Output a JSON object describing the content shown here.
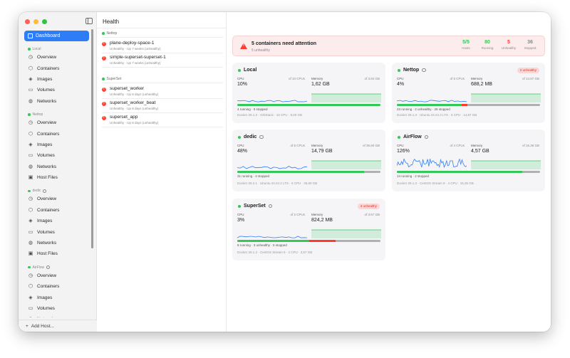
{
  "sidebar": {
    "dashboard_label": "Dashboard",
    "add_host_label": "Add Host...",
    "hosts": [
      {
        "name": "Local",
        "items": [
          "Overview",
          "Containers",
          "Images",
          "Volumes",
          "Networks"
        ]
      },
      {
        "name": "Nettop",
        "items": [
          "Overview",
          "Containers",
          "Images",
          "Volumes",
          "Networks",
          "Host Files"
        ]
      },
      {
        "name": "dedic",
        "items": [
          "Overview",
          "Containers",
          "Images",
          "Volumes",
          "Networks",
          "Host Files"
        ]
      },
      {
        "name": "AirFlow",
        "items": [
          "Overview",
          "Containers",
          "Images",
          "Volumes",
          "Networks"
        ]
      }
    ]
  },
  "health": {
    "title": "Health",
    "groups": [
      {
        "name": "Nettop",
        "rows": [
          {
            "name": "plane-deploy-space-1",
            "status": "Unhealthy · Up 7 weeks (unhealthy)"
          },
          {
            "name": "simple-superset-superset-1",
            "status": "Unhealthy · Up 7 weeks (unhealthy)"
          }
        ]
      },
      {
        "name": "SuperSet",
        "rows": [
          {
            "name": "superset_worker",
            "status": "Unhealthy · Up 8 days (unhealthy)"
          },
          {
            "name": "superset_worker_beat",
            "status": "Unhealthy · Up 8 days (unhealthy)"
          },
          {
            "name": "superset_app",
            "status": "Unhealthy · Up 8 days (unhealthy)"
          }
        ]
      }
    ]
  },
  "alert": {
    "title": "5 containers need attention",
    "subtitle": "5 unhealthy",
    "stats": [
      {
        "value": "5/5",
        "label": "Hosts",
        "color": "#34c759"
      },
      {
        "value": "80",
        "label": "Running",
        "color": "#34c759"
      },
      {
        "value": "5",
        "label": "Unhealthy",
        "color": "#ff3b30"
      },
      {
        "value": "36",
        "label": "Stopped",
        "color": "#8a8a8e"
      }
    ]
  },
  "cards": [
    {
      "name": "Local",
      "info": false,
      "badge": "",
      "cpu_label": "CPU",
      "cpu_total": "of 10 CPUs",
      "cpu": "10%",
      "mem_label": "Memory",
      "mem_total": "of 3.84 GB",
      "mem": "1,62 GB",
      "running": 4,
      "unhealthy": 0,
      "stopped": 0,
      "counts": "4 running · 0 stopped",
      "footer": "Docker 29.1.3 · OrbStack · 10 CPU · 8,00 GB"
    },
    {
      "name": "Nettop",
      "info": true,
      "badge": "2 unhealthy",
      "cpu_label": "CPU",
      "cpu_total": "of 6 CPUs",
      "cpu": "4%",
      "mem_label": "Memory",
      "mem_total": "of 14.87 GB",
      "mem": "688,2 MB",
      "running": 23,
      "unhealthy": 2,
      "stopped": 26,
      "counts": "23 running · 2 unhealthy · 26 stopped",
      "footer": "Docker 29.1.3 · Ubuntu 24.04.3 LTS · 6 CPU · 14,87 GB"
    },
    {
      "name": "dedic",
      "info": true,
      "badge": "",
      "cpu_label": "CPU",
      "cpu_total": "of 6 CPUs",
      "cpu": "48%",
      "mem_label": "Memory",
      "mem_total": "of 35.60 GB",
      "mem": "14,79 GB",
      "running": 31,
      "unhealthy": 0,
      "stopped": 4,
      "counts": "31 running · 4 stopped",
      "footer": "Docker 29.2.1 · Ubuntu 24.04.2 LTS · 6 CPU · 35,60 GB"
    },
    {
      "name": "AirFlow",
      "info": true,
      "badge": "",
      "cpu_label": "CPU",
      "cpu_total": "of 4 CPUs",
      "cpu": "126%",
      "mem_label": "Memory",
      "mem_total": "of 15.36 GB",
      "mem": "4,57 GB",
      "running": 14,
      "unhealthy": 0,
      "stopped": 2,
      "counts": "14 running · 2 stopped",
      "footer": "Docker 29.1.3 · CentOS Stream 9 · 4 CPU · 15,36 GB"
    },
    {
      "name": "SuperSet",
      "info": true,
      "badge": "3 unhealthy",
      "cpu_label": "CPU",
      "cpu_total": "of 2 CPUs",
      "cpu": "3%",
      "mem_label": "Memory",
      "mem_total": "of 3.57 GB",
      "mem": "824,2 MB",
      "running": 8,
      "unhealthy": 3,
      "stopped": 5,
      "counts": "8 running · 3 unhealthy · 5 stopped",
      "footer": "Docker 29.1.2 · CentOS Stream 9 · 2 CPU · 3,57 GB"
    }
  ]
}
